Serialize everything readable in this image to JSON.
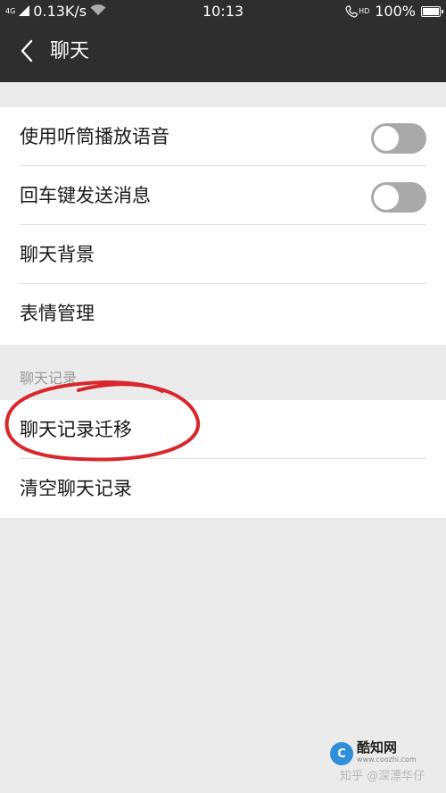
{
  "status_bar": {
    "network_type": "4G",
    "speed": "0.13K/s",
    "time": "10:13",
    "hd_label": "HD",
    "battery": "100%",
    "battery_level": 1.0
  },
  "header": {
    "title": "聊天"
  },
  "settings_group_1": {
    "items": [
      {
        "label": "使用听筒播放语音",
        "toggle": false
      },
      {
        "label": "回车键发送消息",
        "toggle": false
      },
      {
        "label": "聊天背景"
      },
      {
        "label": "表情管理"
      }
    ]
  },
  "section_label": "聊天记录",
  "settings_group_2": {
    "items": [
      {
        "label": "聊天记录迁移"
      },
      {
        "label": "清空聊天记录"
      }
    ]
  },
  "annotation": {
    "color": "#d9262a",
    "shape": "hand-drawn ellipse around 聊天记录迁移"
  },
  "watermark": {
    "brand": "酷知网",
    "url": "www.coozhi.com",
    "credit": "知乎 @深漂华仔"
  },
  "colors": {
    "header_bg": "#2e2e2e",
    "page_bg": "#ebebeb",
    "toggle_off": "#a9a9a9"
  }
}
